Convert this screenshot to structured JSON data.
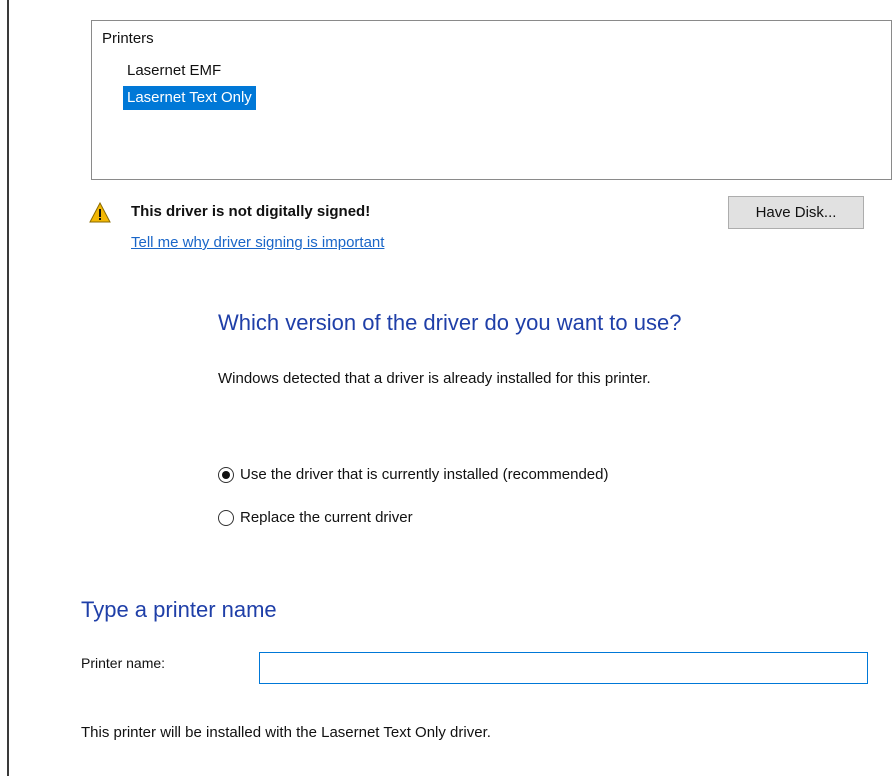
{
  "printers": {
    "header": "Printers",
    "items": [
      {
        "label": "Lasernet EMF",
        "selected": false
      },
      {
        "label": "Lasernet Text Only",
        "selected": true
      }
    ]
  },
  "signing": {
    "warning": "This driver is not digitally signed!",
    "link": "Tell me why driver signing is important",
    "have_disk_label": "Have Disk...",
    "warning_icon": "warning-triangle-icon",
    "warning_color": "#f2b705"
  },
  "driver_version": {
    "question": "Which version of the driver do you want to use?",
    "detected": "Windows detected that a driver is already installed for this printer.",
    "options": [
      {
        "label": "Use the driver that is currently installed (recommended)",
        "checked": true
      },
      {
        "label": "Replace the current driver",
        "checked": false
      }
    ]
  },
  "printer_name": {
    "heading": "Type a printer name",
    "label": "Printer name:",
    "value": "",
    "placeholder": ""
  },
  "footer": {
    "note": "This printer will be installed with the Lasernet Text Only driver."
  },
  "colors": {
    "accent": "#0078d7",
    "heading": "#1f3fa8",
    "link": "#1a66c8"
  }
}
